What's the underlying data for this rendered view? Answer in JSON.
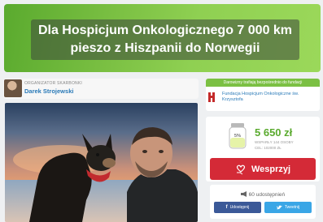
{
  "banner": {
    "title": "Dla Hospicjum Onkologicznego 7 000 km pieszo z Hiszpanii do Norwegii"
  },
  "organizer": {
    "label": "ORGANIZATOR SKARBONKI",
    "name": "Darek Strojewski"
  },
  "fund_info": {
    "header": "Darowizny trafiają bezpośrednio do fundacji",
    "name": "Fundacja Hospicjum Onkologiczne św. Krzysztofa"
  },
  "stats": {
    "amount": "5 650 zł",
    "supporters": "WSPARŁY 144 OSOBY",
    "goal": "CEL: 102000 ZŁ",
    "progress_label": "5%",
    "progress": 0.05
  },
  "donate": {
    "label": "Wesprzyj"
  },
  "share": {
    "count_label": "60 udostępnień",
    "facebook_label": "Udostępnij",
    "twitter_label": "Tweetnij"
  },
  "colors": {
    "accent_green": "#7bc043",
    "donate_red": "#d42a37",
    "facebook": "#3b5998",
    "twitter": "#3aa6e6"
  },
  "icons": [
    "hand-heart-icon",
    "megaphone-icon",
    "facebook-icon",
    "twitter-icon",
    "jar-icon"
  ]
}
